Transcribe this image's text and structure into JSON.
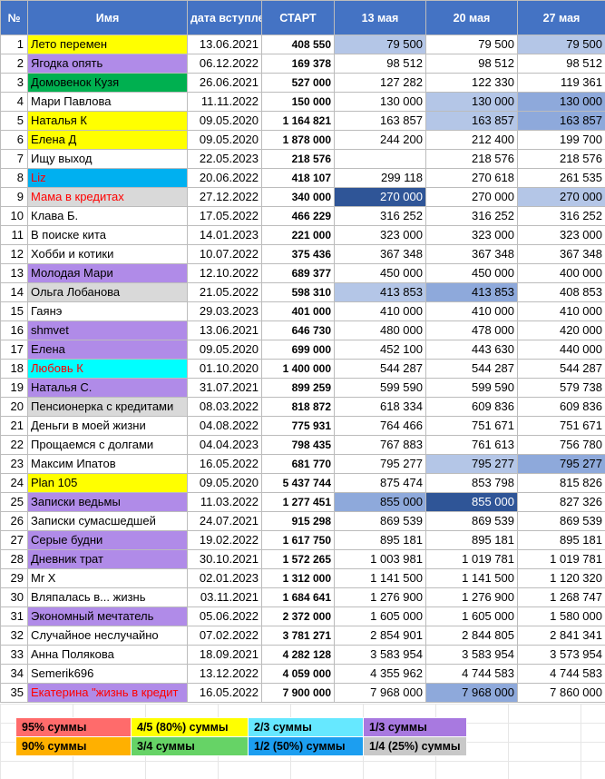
{
  "headers": {
    "idx": "№",
    "name": "Имя",
    "date": "дата вступления",
    "start": "СТАРТ",
    "c1": "13 мая",
    "c2": "20 мая",
    "c3": "27 мая"
  },
  "colors": {
    "yellow": "#ffff00",
    "purple": "#b08be8",
    "green": "#00b050",
    "cyan": "#00ffff",
    "blue": "#00b0f0",
    "grey": "#d9d9d9",
    "light_blue": "#b4c6e7",
    "mid_blue": "#8ea9db",
    "dark_blue": "#2f5597",
    "red_text": "#ff0000"
  },
  "rows": [
    {
      "n": "1",
      "name": "Лето перемен",
      "date": "13.06.2021",
      "start": "408 550",
      "c1": "79 500",
      "c2": "79 500",
      "c3": "79 500",
      "nbg": "yellow",
      "b1": "light_blue",
      "b2": "",
      "b3": "light_blue"
    },
    {
      "n": "2",
      "name": "Ягодка опять",
      "date": "06.12.2022",
      "start": "169 378",
      "c1": "98 512",
      "c2": "98 512",
      "c3": "98 512",
      "nbg": "purple"
    },
    {
      "n": "3",
      "name": "Домовенок Кузя",
      "date": "26.06.2021",
      "start": "527 000",
      "c1": "127 282",
      "c2": "122 330",
      "c3": "119 361",
      "nbg": "green"
    },
    {
      "n": "4",
      "name": "Мари Павлова",
      "date": "11.11.2022",
      "start": "150 000",
      "c1": "130 000",
      "c2": "130 000",
      "c3": "130 000",
      "b2": "light_blue",
      "b3": "mid_blue"
    },
    {
      "n": "5",
      "name": "Наталья К",
      "date": "09.05.2020",
      "start": "1 164 821",
      "c1": "163 857",
      "c2": "163 857",
      "c3": "163 857",
      "nbg": "yellow",
      "b2": "light_blue",
      "b3": "mid_blue"
    },
    {
      "n": "6",
      "name": "Елена Д",
      "date": "09.05.2020",
      "start": "1 878 000",
      "c1": "244 200",
      "c2": "212 400",
      "c3": "199 700",
      "nbg": "yellow"
    },
    {
      "n": "7",
      "name": "Ищу выход",
      "date": "22.05.2023",
      "start": "218 576",
      "c1": "",
      "c2": "218 576",
      "c3": "218 576"
    },
    {
      "n": "8",
      "name": "Liz",
      "date": "20.06.2022",
      "start": "418 107",
      "c1": "299 118",
      "c2": "270 618",
      "c3": "261 535",
      "nbg": "blue",
      "red": true
    },
    {
      "n": "9",
      "name": "Мама в кредитах",
      "date": "27.12.2022",
      "start": "340 000",
      "c1": "270 000",
      "c2": "270 000",
      "c3": "270 000",
      "nbg": "grey",
      "red": true,
      "b1": "dark_blue",
      "w1": true,
      "b3": "light_blue"
    },
    {
      "n": "10",
      "name": "Клава Б.",
      "date": "17.05.2022",
      "start": "466 229",
      "c1": "316 252",
      "c2": "316 252",
      "c3": "316 252"
    },
    {
      "n": "11",
      "name": "В поиске кита",
      "date": "14.01.2023",
      "start": "221 000",
      "c1": "323 000",
      "c2": "323 000",
      "c3": "323 000"
    },
    {
      "n": "12",
      "name": "Хобби и котики",
      "date": "10.07.2022",
      "start": "375 436",
      "c1": "367 348",
      "c2": "367 348",
      "c3": "367 348"
    },
    {
      "n": "13",
      "name": "Молодая Мари",
      "date": "12.10.2022",
      "start": "689 377",
      "c1": "450 000",
      "c2": "450 000",
      "c3": "400 000",
      "nbg": "purple"
    },
    {
      "n": "14",
      "name": "Ольга Лобанова",
      "date": "21.05.2022",
      "start": "598 310",
      "c1": "413 853",
      "c2": "413 853",
      "c3": "408 853",
      "nbg": "grey",
      "b1": "light_blue",
      "b2": "mid_blue"
    },
    {
      "n": "15",
      "name": "Гаянэ",
      "date": "29.03.2023",
      "start": "401 000",
      "c1": "410 000",
      "c2": "410 000",
      "c3": "410 000"
    },
    {
      "n": "16",
      "name": "shmvet",
      "date": "13.06.2021",
      "start": "646 730",
      "c1": "480 000",
      "c2": "478 000",
      "c3": "420 000",
      "nbg": "purple"
    },
    {
      "n": "17",
      "name": "Елена",
      "date": "09.05.2020",
      "start": "699 000",
      "c1": "452 100",
      "c2": "443 630",
      "c3": "440 000",
      "nbg": "purple"
    },
    {
      "n": "18",
      "name": "Любовь К",
      "date": "01.10.2020",
      "start": "1 400 000",
      "c1": "544 287",
      "c2": "544 287",
      "c3": "544 287",
      "nbg": "cyan",
      "red": true
    },
    {
      "n": "19",
      "name": "Наталья С.",
      "date": "31.07.2021",
      "start": "899 259",
      "c1": "599 590",
      "c2": "599 590",
      "c3": "579 738",
      "nbg": "purple"
    },
    {
      "n": "20",
      "name": "Пенсионерка с кредитами",
      "date": "08.03.2022",
      "start": "818 872",
      "c1": "618 334",
      "c2": "609 836",
      "c3": "609 836",
      "nbg": "grey"
    },
    {
      "n": "21",
      "name": "Деньги в моей жизни",
      "date": "04.08.2022",
      "start": "775 931",
      "c1": "764 466",
      "c2": "751 671",
      "c3": "751 671"
    },
    {
      "n": "22",
      "name": "Прощаемся с долгами",
      "date": "04.04.2023",
      "start": "798 435",
      "c1": "767 883",
      "c2": "761 613",
      "c3": "756 780"
    },
    {
      "n": "23",
      "name": "Максим Ипатов",
      "date": "16.05.2022",
      "start": "681 770",
      "c1": "795 277",
      "c2": "795 277",
      "c3": "795 277",
      "b2": "light_blue",
      "b3": "mid_blue"
    },
    {
      "n": "24",
      "name": "Plan 105",
      "date": "09.05.2020",
      "start": "5 437 744",
      "c1": "875 474",
      "c2": "853 798",
      "c3": "815 826",
      "nbg": "yellow"
    },
    {
      "n": "25",
      "name": "Записки ведьмы",
      "date": "11.03.2022",
      "start": "1 277 451",
      "c1": "855 000",
      "c2": "855 000",
      "c3": "827 326",
      "nbg": "purple",
      "b1": "mid_blue",
      "b2": "dark_blue",
      "w2": true
    },
    {
      "n": "26",
      "name": "Записки сумасшедшей",
      "date": "24.07.2021",
      "start": "915 298",
      "c1": "869 539",
      "c2": "869 539",
      "c3": "869 539"
    },
    {
      "n": "27",
      "name": "Серые будни",
      "date": "19.02.2022",
      "start": "1 617 750",
      "c1": "895 181",
      "c2": "895 181",
      "c3": "895 181",
      "nbg": "purple"
    },
    {
      "n": "28",
      "name": "Дневник трат",
      "date": "30.10.2021",
      "start": "1 572 265",
      "c1": "1 003 981",
      "c2": "1 019 781",
      "c3": "1 019 781",
      "nbg": "purple"
    },
    {
      "n": "29",
      "name": "Mr X",
      "date": "02.01.2023",
      "start": "1 312 000",
      "c1": "1 141 500",
      "c2": "1 141 500",
      "c3": "1 120 320"
    },
    {
      "n": "30",
      "name": "Вляпалась в... жизнь",
      "date": "03.11.2021",
      "start": "1 684 641",
      "c1": "1 276 900",
      "c2": "1 276 900",
      "c3": "1 268 747"
    },
    {
      "n": "31",
      "name": "Экономный мечтатель",
      "date": "05.06.2022",
      "start": "2 372 000",
      "c1": "1 605 000",
      "c2": "1 605 000",
      "c3": "1 580 000",
      "nbg": "purple"
    },
    {
      "n": "32",
      "name": "Случайное неслучайно",
      "date": "07.02.2022",
      "start": "3 781 271",
      "c1": "2 854 901",
      "c2": "2 844 805",
      "c3": "2 841 341"
    },
    {
      "n": "33",
      "name": "Анна Полякова",
      "date": "18.09.2021",
      "start": "4 282 128",
      "c1": "3 583 954",
      "c2": "3 583 954",
      "c3": "3 573 954"
    },
    {
      "n": "34",
      "name": "Semerik696",
      "date": "13.12.2022",
      "start": "4 059 000",
      "c1": "4 355 962",
      "c2": "4 744 583",
      "c3": "4 744 583"
    },
    {
      "n": "35",
      "name": "Екатерина \"жизнь в кредит",
      "date": "16.05.2022",
      "start": "7 900 000",
      "c1": "7 968 000",
      "c2": "7 968 000",
      "c3": "7 860 000",
      "nbg": "purple",
      "red": true,
      "b2": "mid_blue"
    }
  ],
  "legend": [
    [
      {
        "label": "95% суммы",
        "bg": "#ff6b6b"
      },
      {
        "label": "4/5 (80%) суммы",
        "bg": "#ffff00"
      },
      {
        "label": "2/3 суммы",
        "bg": "#66e8ff"
      },
      {
        "label": "1/3 суммы",
        "bg": "#a879e0"
      }
    ],
    [
      {
        "label": "90% суммы",
        "bg": "#ffb000"
      },
      {
        "label": "3/4 суммы",
        "bg": "#66d366"
      },
      {
        "label": "1/2 (50%) суммы",
        "bg": "#1c9ef0"
      },
      {
        "label": "1/4 (25%) суммы",
        "bg": "#c8c8c8"
      }
    ]
  ]
}
